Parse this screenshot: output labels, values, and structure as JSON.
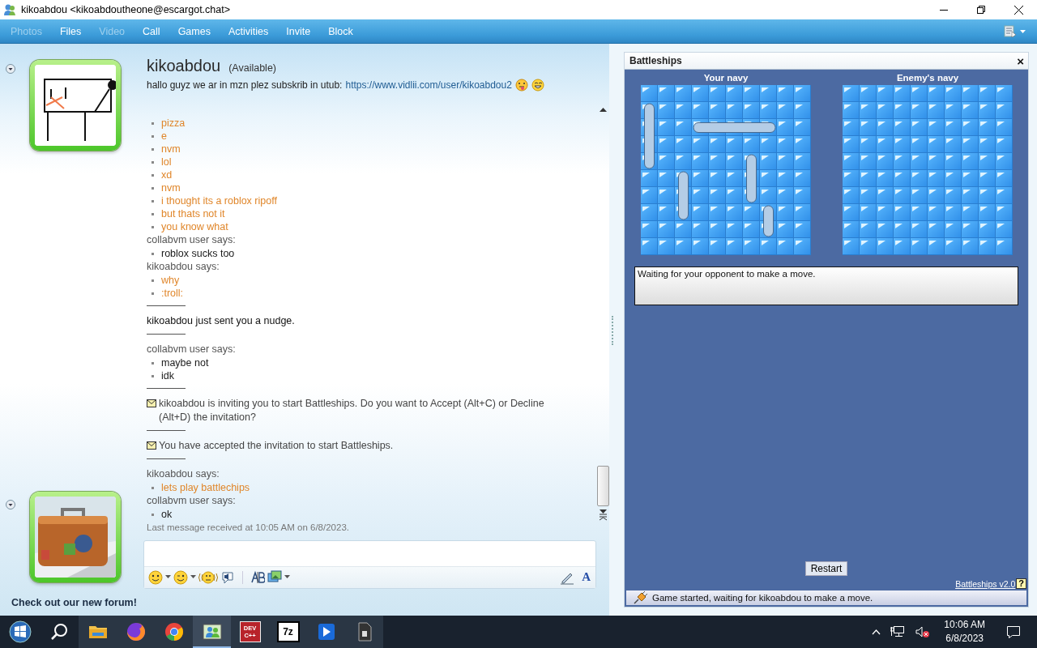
{
  "window": {
    "title": "kikoabdou <kikoabdoutheone@escargot.chat>"
  },
  "menu": [
    {
      "label": "Photos",
      "disabled": true
    },
    {
      "label": "Files",
      "disabled": false
    },
    {
      "label": "Video",
      "disabled": true
    },
    {
      "label": "Call",
      "disabled": false
    },
    {
      "label": "Games",
      "disabled": false
    },
    {
      "label": "Activities",
      "disabled": false
    },
    {
      "label": "Invite",
      "disabled": false
    },
    {
      "label": "Block",
      "disabled": false
    }
  ],
  "contact": {
    "name": "kikoabdou",
    "status": "(Available)",
    "personal_message": "hallo guyz we ar in mzn plez subskrib in utub:",
    "link": "https://www.vidlii.com/user/kikoabdou2"
  },
  "history": [
    {
      "kind": "message",
      "color": "#e0862a",
      "lines": [
        "pizza",
        "e",
        "nvm",
        "lol",
        "xd",
        "nvm",
        "i thought its a roblox ripoff",
        "but thats not it",
        "you know what"
      ]
    },
    {
      "kind": "message",
      "sender": "collabvm user says:",
      "color": "#1a1a1a",
      "lines": [
        "roblox sucks too"
      ]
    },
    {
      "kind": "message",
      "sender": "kikoabdou says:",
      "color": "#e0862a",
      "lines": [
        "why",
        ":troll:"
      ]
    },
    {
      "kind": "notice",
      "text": "kikoabdou just sent you a nudge."
    },
    {
      "kind": "message",
      "sender": "collabvm user says:",
      "color": "#1a1a1a",
      "lines": [
        "maybe not",
        "idk"
      ]
    },
    {
      "kind": "invitation",
      "text": "kikoabdou is inviting you to start Battleships. Do you want to Accept (Alt+C) or Decline (Alt+D) the invitation?"
    },
    {
      "kind": "invitation",
      "text": "You have accepted the invitation to start Battleships."
    },
    {
      "kind": "message",
      "sender": "kikoabdou says:",
      "color": "#e0862a",
      "lines": [
        "lets play battlechips"
      ]
    },
    {
      "kind": "message",
      "sender": "collabvm user says:",
      "color": "#1a1a1a",
      "lines": [
        "ok"
      ]
    }
  ],
  "last_message": "Last message received at 10:05 AM on 6/8/2023.",
  "compose": {
    "font_button": "A"
  },
  "forum_link": "Check out our new forum!",
  "battleships": {
    "title": "Battleships",
    "close": "×",
    "your_navy": {
      "title": "Your navy"
    },
    "enemy_navy": {
      "title": "Enemy's navy"
    },
    "message": "Waiting for your opponent to make a move.",
    "restart": "Restart",
    "version_link": "Battleships v2.0",
    "help": "?",
    "status": "Game started, waiting for kikoabdou to make a move."
  },
  "taskbar": {
    "apps": [
      {
        "kind": "explorer",
        "active": false
      },
      {
        "kind": "firefox",
        "active": false
      },
      {
        "kind": "chrome",
        "active": false
      },
      {
        "kind": "messenger",
        "active": true
      },
      {
        "kind": "devcpp",
        "label": "DEV C++",
        "active": false
      },
      {
        "kind": "sevenzip",
        "label": "7z",
        "active": false
      },
      {
        "kind": "player",
        "active": false
      },
      {
        "kind": "document",
        "active": false
      }
    ],
    "time": "10:06 AM",
    "date": "6/8/2023"
  }
}
